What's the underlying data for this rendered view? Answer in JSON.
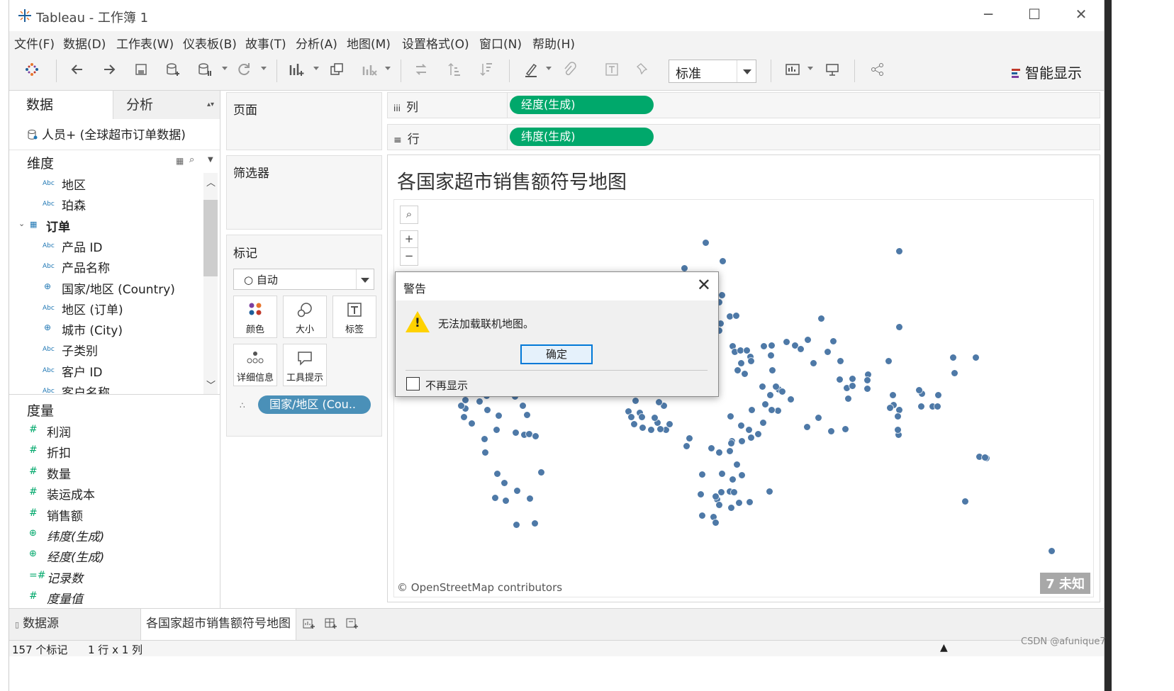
{
  "window": {
    "title": "Tableau - 工作簿 1",
    "controls": {
      "minimize": "─",
      "maximize": "☐",
      "close": "✕"
    }
  },
  "menu": [
    "文件(F)",
    "数据(D)",
    "工作表(W)",
    "仪表板(B)",
    "故事(T)",
    "分析(A)",
    "地图(M)",
    "设置格式(O)",
    "窗口(N)",
    "帮助(H)"
  ],
  "toolbar": {
    "fit_select": "标准",
    "smart_show": "智能显示"
  },
  "left_panel": {
    "tabs": {
      "data": "数据",
      "analysis": "分析"
    },
    "datasource": "人员+ (全球超市订单数据)",
    "dimensions_header": "维度",
    "dimensions": [
      {
        "icon": "Abc",
        "label": "地区"
      },
      {
        "icon": "Abc",
        "label": "珀森"
      },
      {
        "icon": "table",
        "label": "订单",
        "group": true
      },
      {
        "icon": "Abc",
        "label": "产品 ID"
      },
      {
        "icon": "Abc",
        "label": "产品名称"
      },
      {
        "icon": "globe",
        "label": "国家/地区 (Country)"
      },
      {
        "icon": "Abc",
        "label": "地区 (订单)"
      },
      {
        "icon": "globe",
        "label": "城市 (City)"
      },
      {
        "icon": "Abc",
        "label": "子类别"
      },
      {
        "icon": "Abc",
        "label": "客户 ID"
      },
      {
        "icon": "Abc",
        "label": "客户名称"
      }
    ],
    "measures_header": "度量",
    "measures": [
      {
        "icon": "#",
        "label": "利润",
        "italic": false
      },
      {
        "icon": "#",
        "label": "折扣",
        "italic": false
      },
      {
        "icon": "#",
        "label": "数量",
        "italic": false
      },
      {
        "icon": "#",
        "label": "装运成本",
        "italic": false
      },
      {
        "icon": "#",
        "label": "销售额",
        "italic": false
      },
      {
        "icon": "globe",
        "label": "纬度(生成)",
        "italic": true
      },
      {
        "icon": "globe",
        "label": "经度(生成)",
        "italic": true
      },
      {
        "icon": "=#",
        "label": "记录数",
        "italic": true
      },
      {
        "icon": "#",
        "label": "度量值",
        "italic": true
      }
    ]
  },
  "shelves": {
    "pages_label": "页面",
    "filters_label": "筛选器",
    "marks_label": "标记",
    "mark_type": "○ 自动",
    "mark_buttons": [
      "颜色",
      "大小",
      "标签",
      "详细信息",
      "工具提示"
    ],
    "detail_pill": "国家/地区 (Cou..",
    "columns_label": "列",
    "columns_pill": "经度(生成)",
    "rows_label": "行",
    "rows_pill": "纬度(生成)"
  },
  "view": {
    "title": "各国家超市销售额符号地图",
    "attribution": "© OpenStreetMap contributors",
    "unknown_badge": "7 未知"
  },
  "dialog": {
    "title": "警告",
    "message": "无法加载联机地图。",
    "ok": "确定",
    "dont_show": "不再显示"
  },
  "sheet_tabs": {
    "datasource": "数据源",
    "active": "各国家超市销售额符号地图"
  },
  "status": {
    "marks": "157 个标记",
    "grid": "1 行 x 1 列"
  },
  "watermark": "CSDN @afunique7"
}
